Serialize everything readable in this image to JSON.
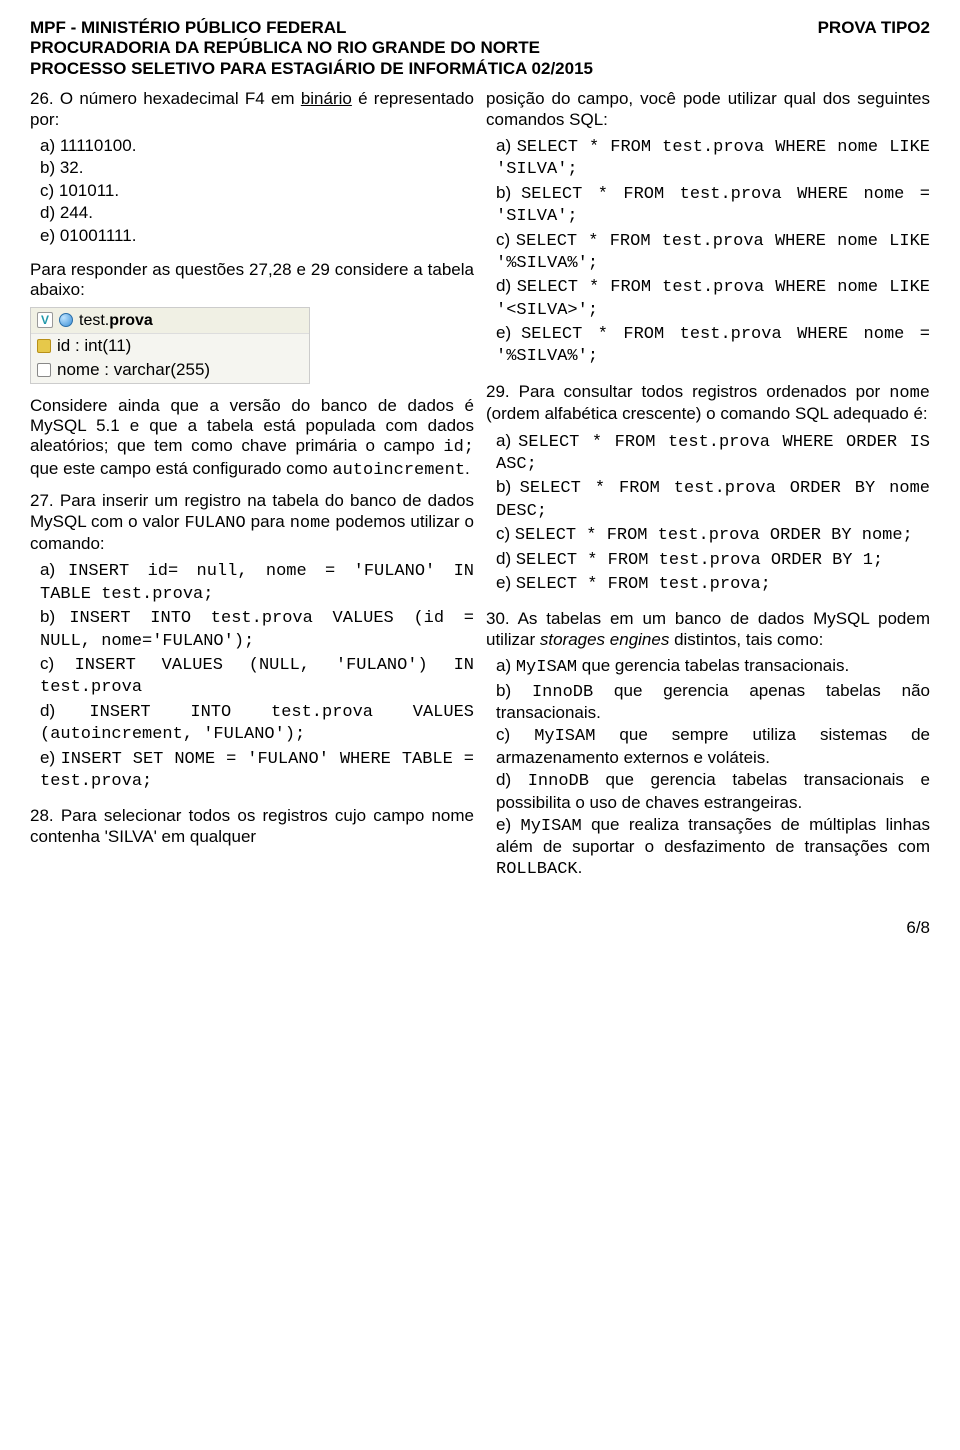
{
  "header": {
    "org": "MPF - MINISTÉRIO PÚBLICO FEDERAL",
    "prova": "PROVA TIPO2",
    "line2": "PROCURADORIA DA REPÚBLICA NO RIO GRANDE DO NORTE",
    "line3": "PROCESSO SELETIVO PARA ESTAGIÁRIO DE INFORMÁTICA 02/2015"
  },
  "q26": {
    "text_before": "26. O número hexadecimal F4 em ",
    "underlined": "binário",
    "text_after": " é representado por:",
    "a": "a) 11110100.",
    "b": "b) 32.",
    "c": "c) 101011.",
    "d": "d) 244.",
    "e": "e) 01001111."
  },
  "intro2728": "Para responder as questões 27,28 e 29 considere a tabela abaixo:",
  "table": {
    "name_plain": "test.",
    "name_bold": "prova",
    "col1": "id : int(11)",
    "col2": "nome : varchar(255)"
  },
  "context": {
    "p1a": "Considere ainda que a versão do banco de dados é MySQL 5.1 e que a tabela está populada com dados aleatórios; que tem como chave primária o campo ",
    "code1": "id;",
    "p1b": " que este campo está configurado como ",
    "code2": "autoincrement",
    "p1c": "."
  },
  "q27": {
    "t1": "27. Para inserir um registro na tabela do banco de dados MySQL com o valor ",
    "c1": "FULANO",
    "t2": " para ",
    "c2": "nome",
    "t3": " podemos utilizar o comando:",
    "a_pref": "a) ",
    "a": "INSERT id= null, nome = 'FULANO' IN TABLE test.prova;",
    "b_pref": "b) ",
    "b": "INSERT INTO test.prova VALUES (id = NULL, nome='FULANO');",
    "c_pref": "c) ",
    "c": "INSERT VALUES (NULL, 'FULANO') IN test.prova",
    "d_pref": "d) ",
    "d": "INSERT INTO test.prova VALUES (autoincrement, 'FULANO');",
    "e_pref": "e) ",
    "e": "INSERT SET NOME = 'FULANO' WHERE TABLE = test.prova;"
  },
  "q28": {
    "t1": "28. Para selecionar todos os registros cujo campo nome contenha 'SILVA' em qualquer ",
    "t2": "posição do campo, você pode utilizar qual dos seguintes comandos SQL:",
    "a_pref": "a) ",
    "a": "SELECT * FROM test.prova WHERE nome LIKE 'SILVA';",
    "b_pref": "b) ",
    "b": "SELECT * FROM test.prova WHERE nome = 'SILVA';",
    "c_pref": "c) ",
    "c": "SELECT * FROM test.prova WHERE nome LIKE '%SILVA%';",
    "d_pref": "d) ",
    "d": "SELECT * FROM test.prova WHERE nome LIKE '<SILVA>';",
    "e_pref": "e) ",
    "e": "SELECT * FROM test.prova WHERE nome = '%SILVA%';"
  },
  "q29": {
    "t1": "29. Para consultar todos registros ordenados por ",
    "c1": "nome",
    "t2": " (ordem alfabética crescente) o comando SQL adequado é:",
    "a_pref": "a) ",
    "a": "SELECT * FROM test.prova WHERE ORDER IS ASC;",
    "b_pref": "b) ",
    "b": "SELECT * FROM test.prova ORDER BY nome DESC;",
    "c_pref": "c) ",
    "c": "SELECT * FROM test.prova ORDER BY nome;",
    "d_pref": "d) ",
    "d": "SELECT * FROM test.prova ORDER BY 1;",
    "e_pref": "e) ",
    "e": "SELECT * FROM test.prova;"
  },
  "q30": {
    "t1": "30. As tabelas em um banco de dados MySQL podem utilizar ",
    "italic": "storages engines",
    "t2": " distintos, tais como:",
    "a_pref": "a) ",
    "a_code": "MyISAM",
    "a_rest": " que gerencia tabelas transacionais.",
    "b_pref": "b) ",
    "b_code": "InnoDB",
    "b_rest": " que gerencia apenas tabelas não transacionais.",
    "c_pref": "c) ",
    "c_code": "MyISAM",
    "c_rest": " que sempre utiliza sistemas de armazenamento externos e voláteis.",
    "d_pref": "d) ",
    "d_code": "InnoDB",
    "d_rest": " que gerencia tabelas transacionais e possibilita o uso de chaves estrangeiras.",
    "e_pref": "e) ",
    "e_code": "MyISAM",
    "e_rest1": " que realiza transações de múltiplas linhas além de suportar o desfazimento de transações com ",
    "e_code2": "ROLLBACK",
    "e_rest2": "."
  },
  "footer": "6/8"
}
